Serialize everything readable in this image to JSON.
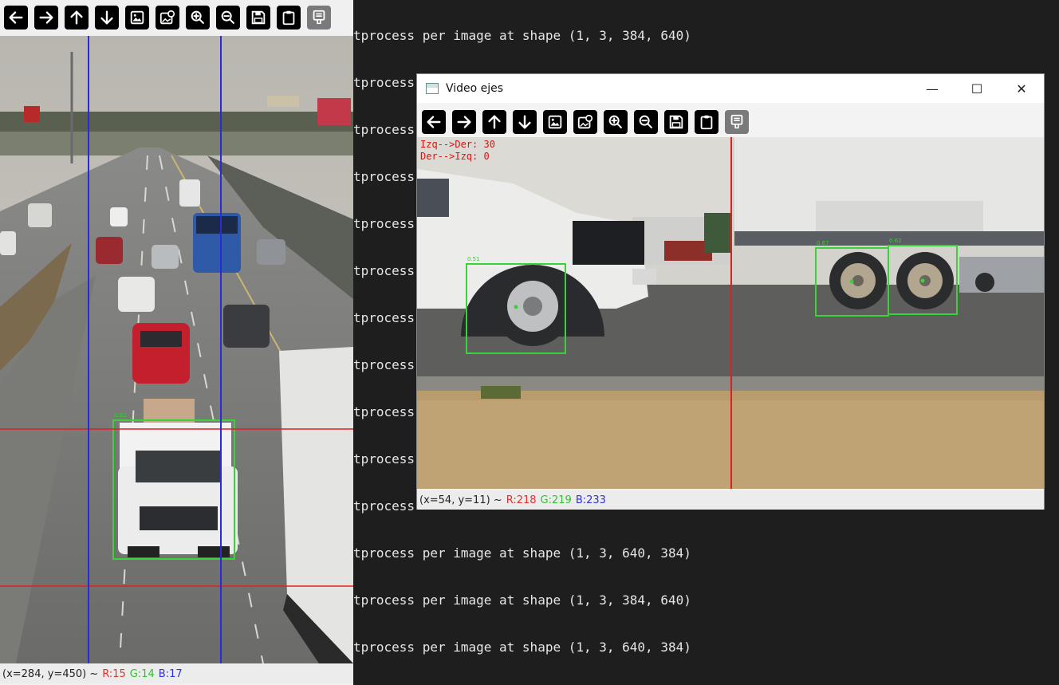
{
  "terminal": {
    "lines": [
      "tprocess per image at shape (1, 3, 384, 640)",
      "tprocess",
      "tprocess",
      "tprocess",
      "tprocess",
      "tprocess",
      "tprocess",
      "tprocess",
      "tprocess",
      "tprocess",
      "tprocess",
      "tprocess per image at shape (1, 3, 640, 384)",
      "tprocess per image at shape (1, 3, 384, 640)",
      "tprocess per image at shape (1, 3, 640, 384)"
    ]
  },
  "left_window": {
    "status": {
      "coords": "(x=284, y=450) ~",
      "r": "R:15",
      "g": "G:14",
      "b": "B:17"
    },
    "detection_label": "0.82"
  },
  "right_window": {
    "title": "Video ejes",
    "controls": {
      "minimize": "—",
      "maximize": "☐",
      "close": "✕"
    },
    "counters": {
      "left_to_right": "Izq-->Der: 30",
      "right_to_left": "Der-->Izq: 0"
    },
    "status": {
      "coords": "(x=54, y=11) ~",
      "r": "R:218",
      "g": "G:219",
      "b": "B:233"
    },
    "detection_labels": [
      "0.51",
      "0.67",
      "0.62"
    ]
  },
  "toolbar_icons": [
    "arrow-left-icon",
    "arrow-right-icon",
    "arrow-up-icon",
    "arrow-down-icon",
    "zoom-fit-icon",
    "zoom-original-icon",
    "zoom-in-icon",
    "zoom-out-icon",
    "save-icon",
    "copy-clipboard-icon",
    "properties-icon"
  ],
  "colors": {
    "terminal_bg": "#1e1e1e",
    "terminal_text": "#e6e6e6",
    "box_green": "#39d239",
    "line_red": "#e02020",
    "line_blue": "#2a2ad8"
  }
}
